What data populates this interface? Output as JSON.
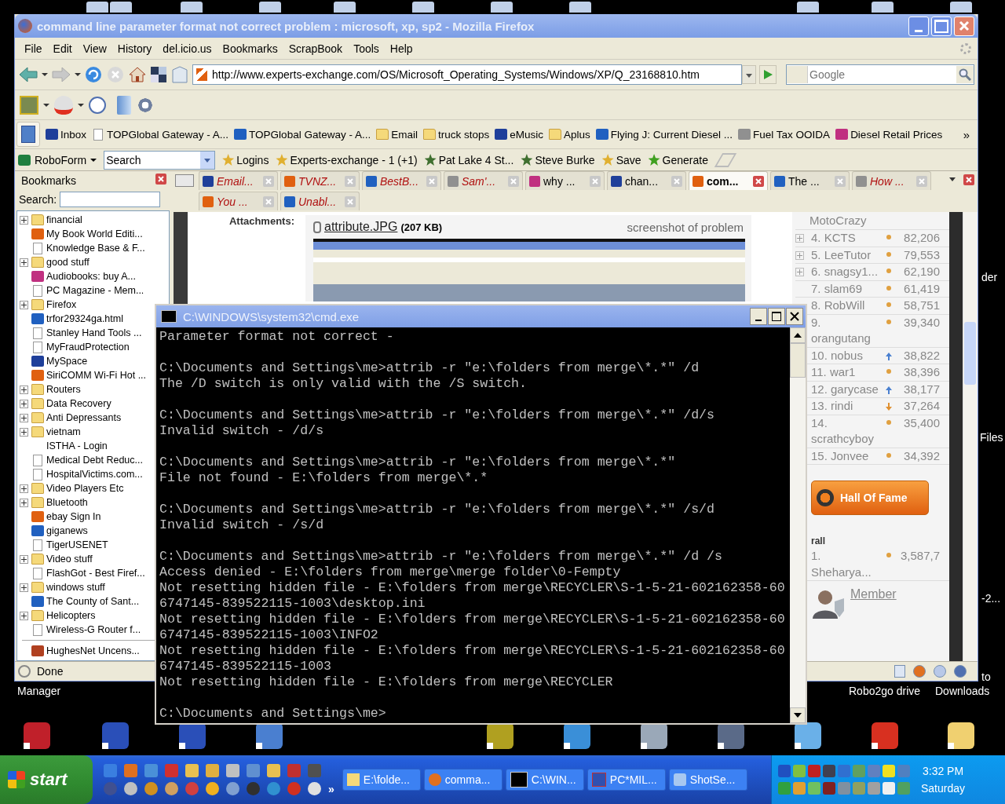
{
  "desktop": {
    "labels": [
      "Manager",
      "Robo2go drive",
      "Downloads",
      "der",
      "Files",
      "-2...",
      "to"
    ]
  },
  "firefox": {
    "title": "command line parameter format not correct problem : microsoft, xp, sp2 - Mozilla Firefox",
    "menu": [
      "File",
      "Edit",
      "View",
      "History",
      "del.icio.us",
      "Bookmarks",
      "ScrapBook",
      "Tools",
      "Help"
    ],
    "url": "http://www.experts-exchange.com/OS/Microsoft_Operating_Systems/Windows/XP/Q_23168810.htm",
    "search_placeholder": "Google",
    "bookmarks_bar": [
      {
        "label": "Inbox",
        "kind": "site"
      },
      {
        "label": "TOPGlobal Gateway - A...",
        "kind": "page"
      },
      {
        "label": "TOPGlobal Gateway - A...",
        "kind": "site"
      },
      {
        "label": "Email",
        "kind": "folder"
      },
      {
        "label": "truck stops",
        "kind": "folder"
      },
      {
        "label": "eMusic",
        "kind": "site"
      },
      {
        "label": "Aplus",
        "kind": "folder"
      },
      {
        "label": "Flying J: Current Diesel ...",
        "kind": "site"
      },
      {
        "label": "Fuel Tax OOIDA",
        "kind": "site"
      },
      {
        "label": "Diesel Retail Prices",
        "kind": "site"
      }
    ],
    "bookmarks_more": "»",
    "roboform": {
      "label": "RoboForm",
      "search_placeholder": "Search",
      "items": [
        "Logins",
        "Experts-exchange - 1 (+1)",
        "Pat Lake 4 St...",
        "Steve Burke",
        "Save",
        "Generate"
      ]
    },
    "sidebar": {
      "title": "Bookmarks",
      "search_label": "Search:",
      "items": [
        {
          "label": "financial",
          "kind": "folder",
          "expanded": false
        },
        {
          "label": "My Book World Editi...",
          "kind": "site"
        },
        {
          "label": "Knowledge Base & F...",
          "kind": "page"
        },
        {
          "label": "good stuff",
          "kind": "folder",
          "expanded": false
        },
        {
          "label": "Audiobooks: buy A...",
          "kind": "site"
        },
        {
          "label": "PC Magazine - Mem...",
          "kind": "page"
        },
        {
          "label": "Firefox",
          "kind": "folder",
          "expanded": false
        },
        {
          "label": "trfor29324ga.html",
          "kind": "site"
        },
        {
          "label": "Stanley Hand Tools ...",
          "kind": "page"
        },
        {
          "label": "MyFraudProtection",
          "kind": "page"
        },
        {
          "label": "MySpace",
          "kind": "site"
        },
        {
          "label": "SiriCOMM Wi-Fi Hot ...",
          "kind": "site"
        },
        {
          "label": "Routers",
          "kind": "folder",
          "expanded": false
        },
        {
          "label": "Data Recovery",
          "kind": "folder",
          "expanded": false
        },
        {
          "label": "Anti Depressants",
          "kind": "folder",
          "expanded": false
        },
        {
          "label": "vietnam",
          "kind": "folder",
          "expanded": false
        },
        {
          "label": "ISTHA - Login",
          "kind": "blank"
        },
        {
          "label": "Medical Debt Reduc...",
          "kind": "page"
        },
        {
          "label": "HospitalVictims.com...",
          "kind": "page"
        },
        {
          "label": "Video Players Etc",
          "kind": "folder",
          "expanded": false
        },
        {
          "label": "Bluetooth",
          "kind": "folder",
          "expanded": false
        },
        {
          "label": "ebay Sign In",
          "kind": "site"
        },
        {
          "label": "giganews",
          "kind": "site"
        },
        {
          "label": "TigerUSENET",
          "kind": "page"
        },
        {
          "label": "Video stuff",
          "kind": "folder",
          "expanded": false
        },
        {
          "label": "FlashGot - Best Firef...",
          "kind": "page"
        },
        {
          "label": "windows stuff",
          "kind": "folder",
          "expanded": false
        },
        {
          "label": "The County of Sant...",
          "kind": "site"
        },
        {
          "label": "Helicopters",
          "kind": "folder",
          "expanded": false
        },
        {
          "label": "Wireless-G Router f...",
          "kind": "page"
        }
      ],
      "after_separator": "HughesNet Uncens..."
    },
    "tab_rows": [
      [
        {
          "label": "Email...",
          "selected": false,
          "unread": true
        },
        {
          "label": "TVNZ...",
          "selected": false,
          "unread": true
        },
        {
          "label": "BestB...",
          "selected": false,
          "unread": true
        },
        {
          "label": "Sam'...",
          "selected": false,
          "unread": true
        },
        {
          "label": "why ...",
          "selected": false,
          "unread": false
        },
        {
          "label": "chan...",
          "selected": false,
          "unread": false
        },
        {
          "label": "com...",
          "selected": true,
          "unread": false
        },
        {
          "label": "The ...",
          "selected": false,
          "unread": false
        },
        {
          "label": "How ...",
          "selected": false,
          "unread": true
        }
      ],
      [
        {
          "label": "You ...",
          "selected": false,
          "unread": true
        },
        {
          "label": "Unabl...",
          "selected": false,
          "unread": true
        }
      ]
    ],
    "page": {
      "attachments_label": "Attachments:",
      "file_link": "attribute.JPG",
      "file_size": "(207 KB)",
      "caption": "screenshot of problem",
      "ranking_cut_top": "MotoCrazy",
      "ranking": [
        {
          "rank": "4.",
          "name": "KCTS",
          "points": "82,206",
          "kind": "dot",
          "expandable": true
        },
        {
          "rank": "5.",
          "name": "LeeTutor",
          "points": "79,553",
          "kind": "dot",
          "expandable": true
        },
        {
          "rank": "6.",
          "name": "snagsy1...",
          "points": "62,190",
          "kind": "dot",
          "expandable": true
        },
        {
          "rank": "7.",
          "name": "slam69",
          "points": "61,419",
          "kind": "dot",
          "expandable": false
        },
        {
          "rank": "8.",
          "name": "RobWill",
          "points": "58,751",
          "kind": "dot",
          "expandable": false
        },
        {
          "rank": "9.",
          "name": "orangutang",
          "points": "39,340",
          "kind": "dot",
          "expandable": false
        },
        {
          "rank": "10.",
          "name": "nobus",
          "points": "38,822",
          "kind": "up",
          "expandable": false
        },
        {
          "rank": "11.",
          "name": "war1",
          "points": "38,396",
          "kind": "dot",
          "expandable": false
        },
        {
          "rank": "12.",
          "name": "garycase",
          "points": "38,177",
          "kind": "up",
          "expandable": false
        },
        {
          "rank": "13.",
          "name": "rindi",
          "points": "37,264",
          "kind": "down",
          "expandable": false
        },
        {
          "rank": "14.",
          "name": "scrathcyboy",
          "points": "35,400",
          "kind": "dot",
          "expandable": false
        },
        {
          "rank": "15.",
          "name": "Jonvee",
          "points": "34,392",
          "kind": "dot",
          "expandable": false
        }
      ],
      "hall_of_fame": "Hall Of Fame",
      "overall_heading": "rall",
      "overall": [
        {
          "rank": "1.",
          "name": "Sheharya...",
          "points": "3,587,7",
          "kind": "dot"
        }
      ],
      "member_link": "Member"
    },
    "status": "Done"
  },
  "cmd": {
    "title": "C:\\WINDOWS\\system32\\cmd.exe",
    "blocks": [
      [
        "Parameter format not correct -"
      ],
      [
        "C:\\Documents and Settings\\me>attrib -r \"e:\\folders from merge\\*.*\" /d",
        "The /D switch is only valid with the /S switch."
      ],
      [
        "C:\\Documents and Settings\\me>attrib -r \"e:\\folders from merge\\*.*\" /d/s",
        "Invalid switch - /d/s"
      ],
      [
        "C:\\Documents and Settings\\me>attrib -r \"e:\\folders from merge\\*.*\"",
        "File not found - E:\\folders from merge\\*.*"
      ],
      [
        "C:\\Documents and Settings\\me>attrib -r \"e:\\folders from merge\\*.*\" /s/d",
        "Invalid switch - /s/d"
      ],
      [
        "C:\\Documents and Settings\\me>attrib -r \"e:\\folders from merge\\*.*\" /d /s",
        "Access denied - E:\\folders from merge\\merge folder\\0-Fempty",
        "Not resetting hidden file - E:\\folders from merge\\RECYCLER\\S-1-5-21-602162358-60",
        "6747145-839522115-1003\\desktop.ini",
        "Not resetting hidden file - E:\\folders from merge\\RECYCLER\\S-1-5-21-602162358-60",
        "6747145-839522115-1003\\INFO2",
        "Not resetting hidden file - E:\\folders from merge\\RECYCLER\\S-1-5-21-602162358-60",
        "6747145-839522115-1003",
        "Not resetting hidden file - E:\\folders from merge\\RECYCLER"
      ],
      [
        "C:\\Documents and Settings\\me>"
      ]
    ]
  },
  "taskbar": {
    "start": "start",
    "quick_launch_more": "»",
    "tasks": [
      {
        "label": "E:\\folde...",
        "kind": "folder",
        "selected": false
      },
      {
        "label": "comma...",
        "kind": "firefox",
        "selected": false
      },
      {
        "label": "C:\\WIN...",
        "kind": "console",
        "selected": false
      },
      {
        "label": "PC*MIL...",
        "kind": "shield",
        "selected": false
      },
      {
        "label": "ShotSe...",
        "kind": "camera",
        "selected": false
      }
    ],
    "clock": "3:32 PM",
    "day": "Saturday"
  }
}
